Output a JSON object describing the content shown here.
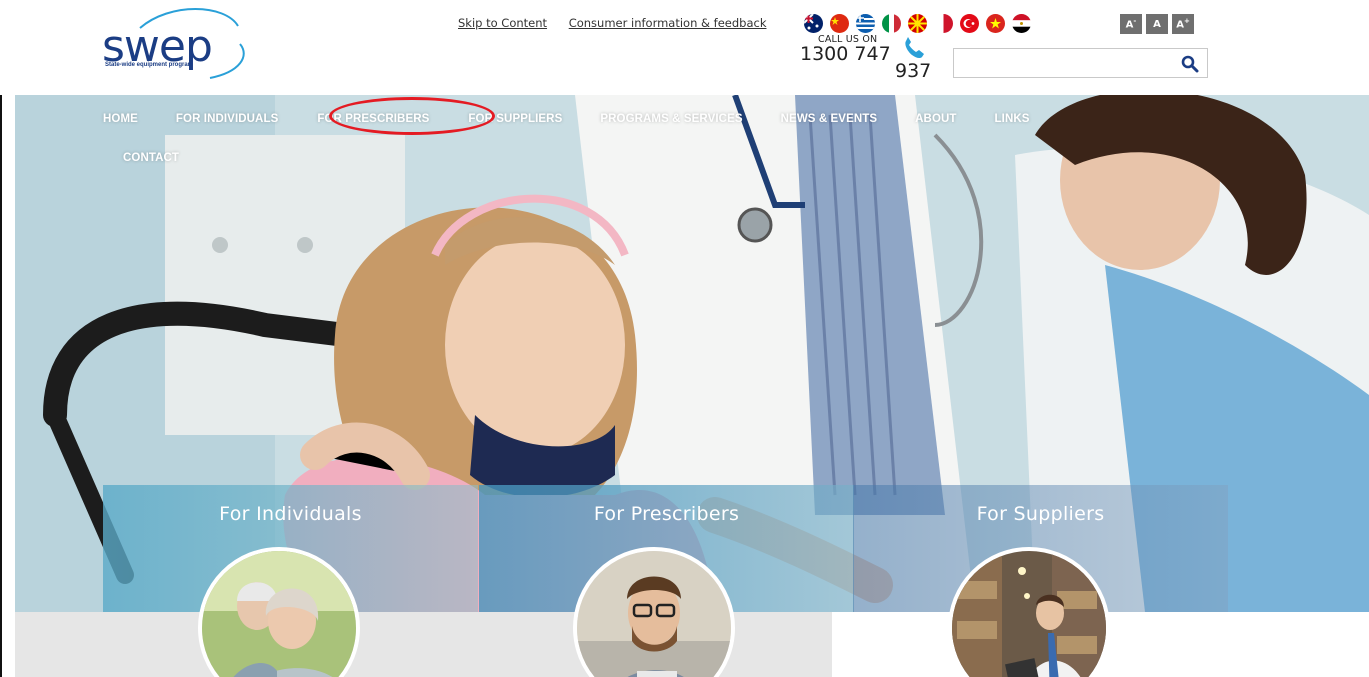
{
  "header": {
    "logo_text": "swep",
    "logo_tagline": "State-wide equipment program",
    "links": [
      "Skip to Content",
      "Consumer information & feedback"
    ],
    "languages": [
      "australia-flag",
      "china-flag",
      "greece-flag",
      "italy-flag",
      "macedonia-flag",
      "malta-flag",
      "turkey-flag",
      "vietnam-flag",
      "egypt-flag"
    ],
    "font_sizes": {
      "smaller": "A",
      "normal": "A",
      "larger": "A"
    },
    "call_label": "CALL US ON",
    "phone_part1": "1300 747",
    "phone_part2": "937",
    "search_placeholder": "",
    "search_value": ""
  },
  "nav": {
    "row1": [
      "HOME",
      "FOR INDIVIDUALS",
      "FOR PRESCRIBERS",
      "FOR SUPPLIERS",
      "PROGRAMS & SERVICES",
      "NEWS & EVENTS",
      "ABOUT",
      "LINKS"
    ],
    "row2": [
      "CONTACT"
    ],
    "highlighted": "FOR PRESCRIBERS"
  },
  "tiles": [
    {
      "title": "For Individuals",
      "image": "elderly-couple-photo"
    },
    {
      "title": "For Prescribers",
      "image": "smiling-man-glasses-photo"
    },
    {
      "title": "For Suppliers",
      "image": "warehouse-worker-photo"
    }
  ],
  "colors": {
    "brand_blue": "#1b3d84",
    "brand_light_blue": "#2aa0d8",
    "highlight_red": "#e41b23",
    "font_button_grey": "#6f6f6f",
    "search_icon": "#1b3d84"
  }
}
